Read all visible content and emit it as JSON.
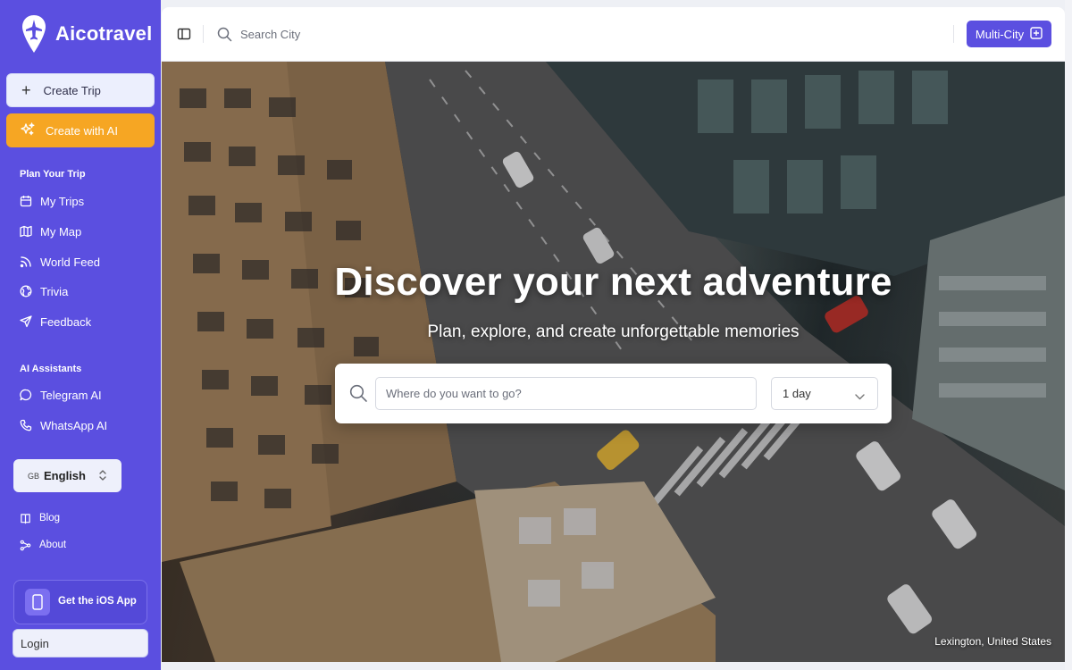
{
  "app": {
    "brand": "Aicotravel"
  },
  "sidebar": {
    "create_trip": "Create Trip",
    "create_ai": "Create with AI",
    "section_plan": "Plan Your Trip",
    "plan_items": [
      {
        "label": "My Trips",
        "icon": "calendar-icon"
      },
      {
        "label": "My Map",
        "icon": "map-icon"
      },
      {
        "label": "World Feed",
        "icon": "rss-icon"
      },
      {
        "label": "Trivia",
        "icon": "globe-icon"
      },
      {
        "label": "Feedback",
        "icon": "send-icon"
      }
    ],
    "section_ai": "AI Assistants",
    "ai_items": [
      {
        "label": "Telegram AI",
        "icon": "chat-bubble-icon"
      },
      {
        "label": "WhatsApp AI",
        "icon": "phone-icon"
      }
    ],
    "language": {
      "code": "GB",
      "name": "English"
    },
    "links": [
      {
        "label": "Blog",
        "icon": "book-icon"
      },
      {
        "label": "About",
        "icon": "share-icon"
      }
    ],
    "ios_app": "Get the iOS App",
    "login": "Login"
  },
  "topbar": {
    "search_placeholder": "Search City",
    "multi_city": "Multi-City"
  },
  "hero": {
    "title": "Discover your next adventure",
    "subtitle": "Plan, explore, and create unforgettable memories",
    "destination_placeholder": "Where do you want to go?",
    "days_value": "1 day",
    "location_caption": "Lexington, United States"
  },
  "colors": {
    "sidebar_bg": "#5b4fe0",
    "accent_orange": "#f6a623",
    "primary": "#5b4fe0"
  }
}
